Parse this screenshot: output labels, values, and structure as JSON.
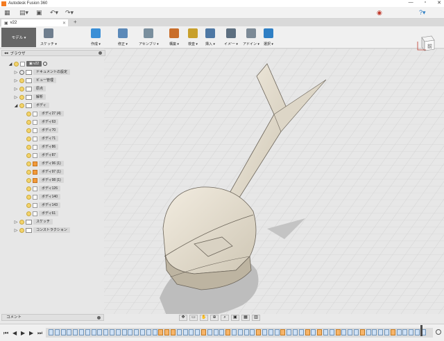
{
  "window": {
    "title": "Autodesk Fusion 360"
  },
  "document_tab": {
    "label": "v22"
  },
  "toolbar": {
    "workspace": "モデル ▾",
    "items": [
      {
        "label": "スケッチ ▾",
        "color": "#6f7e8e"
      },
      {
        "label": "作成 ▾",
        "color": "#3a8fd6"
      },
      {
        "label": "修正 ▾",
        "color": "#5b89b8"
      },
      {
        "label": "アセンブリ ▾",
        "color": "#7a8f9e"
      },
      {
        "label": "構築 ▾",
        "color": "#c96e2b"
      },
      {
        "label": "検査 ▾",
        "color": "#c8a02c"
      },
      {
        "label": "挿入 ▾",
        "color": "#4e78a4"
      },
      {
        "label": "イメ'ー ▾",
        "color": "#5d6f80"
      },
      {
        "label": "アドイン ▾",
        "color": "#7c8a96"
      },
      {
        "label": "選択 ▾",
        "color": "#2f7fc4"
      }
    ]
  },
  "browser": {
    "title": "ブラウザ",
    "root_label": "v22",
    "items": [
      {
        "label": "ドキュメントの設定",
        "kind": "gear",
        "level": 1
      },
      {
        "label": "ビュー管理",
        "kind": "folder",
        "level": 1
      },
      {
        "label": "原点",
        "kind": "folder",
        "level": 1
      },
      {
        "label": "解析",
        "kind": "folder",
        "level": 1
      },
      {
        "label": "ボディ",
        "kind": "folder",
        "level": 1,
        "expanded": true
      },
      {
        "label": "ボディ27 (4)",
        "kind": "body",
        "level": 2
      },
      {
        "label": "ボディ63",
        "kind": "body",
        "level": 2
      },
      {
        "label": "ボディ70",
        "kind": "body",
        "level": 2
      },
      {
        "label": "ボディ71",
        "kind": "body",
        "level": 2
      },
      {
        "label": "ボディ86",
        "kind": "body",
        "level": 2
      },
      {
        "label": "ボディ87",
        "kind": "body",
        "level": 2
      },
      {
        "label": "ボディ96 (1)",
        "kind": "body-orange",
        "level": 2
      },
      {
        "label": "ボディ97 (1)",
        "kind": "body-orange",
        "level": 2
      },
      {
        "label": "ボディ98 (1)",
        "kind": "body-orange",
        "level": 2
      },
      {
        "label": "ボディ126",
        "kind": "body",
        "level": 2
      },
      {
        "label": "ボディ140",
        "kind": "body",
        "level": 2
      },
      {
        "label": "ボディ143",
        "kind": "body",
        "level": 2
      },
      {
        "label": "ボディ61",
        "kind": "body",
        "level": 2
      },
      {
        "label": "スケッチ",
        "kind": "folder",
        "level": 1
      },
      {
        "label": "コンストラクション",
        "kind": "folder",
        "level": 1
      }
    ]
  },
  "comment_panel": {
    "title": "コメント"
  },
  "viewcube": {
    "face_label": "前"
  }
}
